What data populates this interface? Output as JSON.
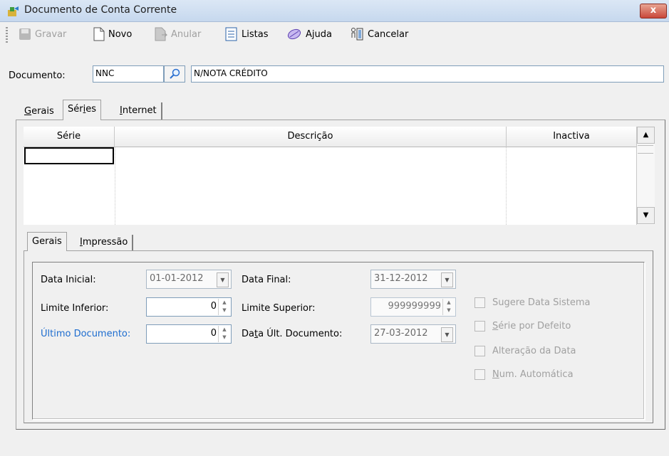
{
  "window": {
    "title": "Documento de Conta Corrente",
    "close_glyph": "x"
  },
  "toolbar": {
    "gravar": "Gravar",
    "novo": "Novo",
    "anular": "Anular",
    "listas": "Listas",
    "ajuda": "Ajuda",
    "cancelar": "Cancelar"
  },
  "document": {
    "label": "Documento:",
    "code": "NNC",
    "description": "N/NOTA CRÉDITO"
  },
  "tabs": [
    {
      "label": "Gerais",
      "underline": "G",
      "rest": "erais"
    },
    {
      "label": "Séries",
      "pre": "Sér",
      "underline": "i",
      "post": "es"
    },
    {
      "label": "Internet",
      "underline": "I",
      "rest": "nternet"
    }
  ],
  "grid": {
    "columns": [
      "Série",
      "Descrição",
      "Inactiva"
    ],
    "rows": []
  },
  "subtabs": [
    {
      "label": "Gerais"
    },
    {
      "label": "Impressão",
      "underline": "I",
      "rest": "mpressão"
    }
  ],
  "form": {
    "data_inicial_label": "Data Inicial:",
    "data_inicial": "01-01-2012",
    "data_final_label": "Data Final:",
    "data_final": "31-12-2012",
    "limite_inferior_label": "Limite Inferior:",
    "limite_inferior": "0",
    "limite_superior_label": "Limite Superior:",
    "limite_superior": "999999999",
    "ultimo_documento_label": "Último Documento:",
    "ultimo_documento": "0",
    "data_ult_label_pre": "Da",
    "data_ult_label_u": "t",
    "data_ult_label_post": "a Últ. Documento:",
    "data_ult_documento": "27-03-2012"
  },
  "options": [
    {
      "label": "Sugere Data Sistema",
      "checked": false
    },
    {
      "pre": "",
      "underline": "S",
      "post": "érie por Defeito",
      "checked": false
    },
    {
      "label": "Alteração da Data",
      "checked": false
    },
    {
      "pre": "",
      "underline": "N",
      "post": "um. Automática",
      "checked": false
    }
  ],
  "colors": {
    "link": "#1c6ccf",
    "disabled": "#a0a0a0"
  }
}
